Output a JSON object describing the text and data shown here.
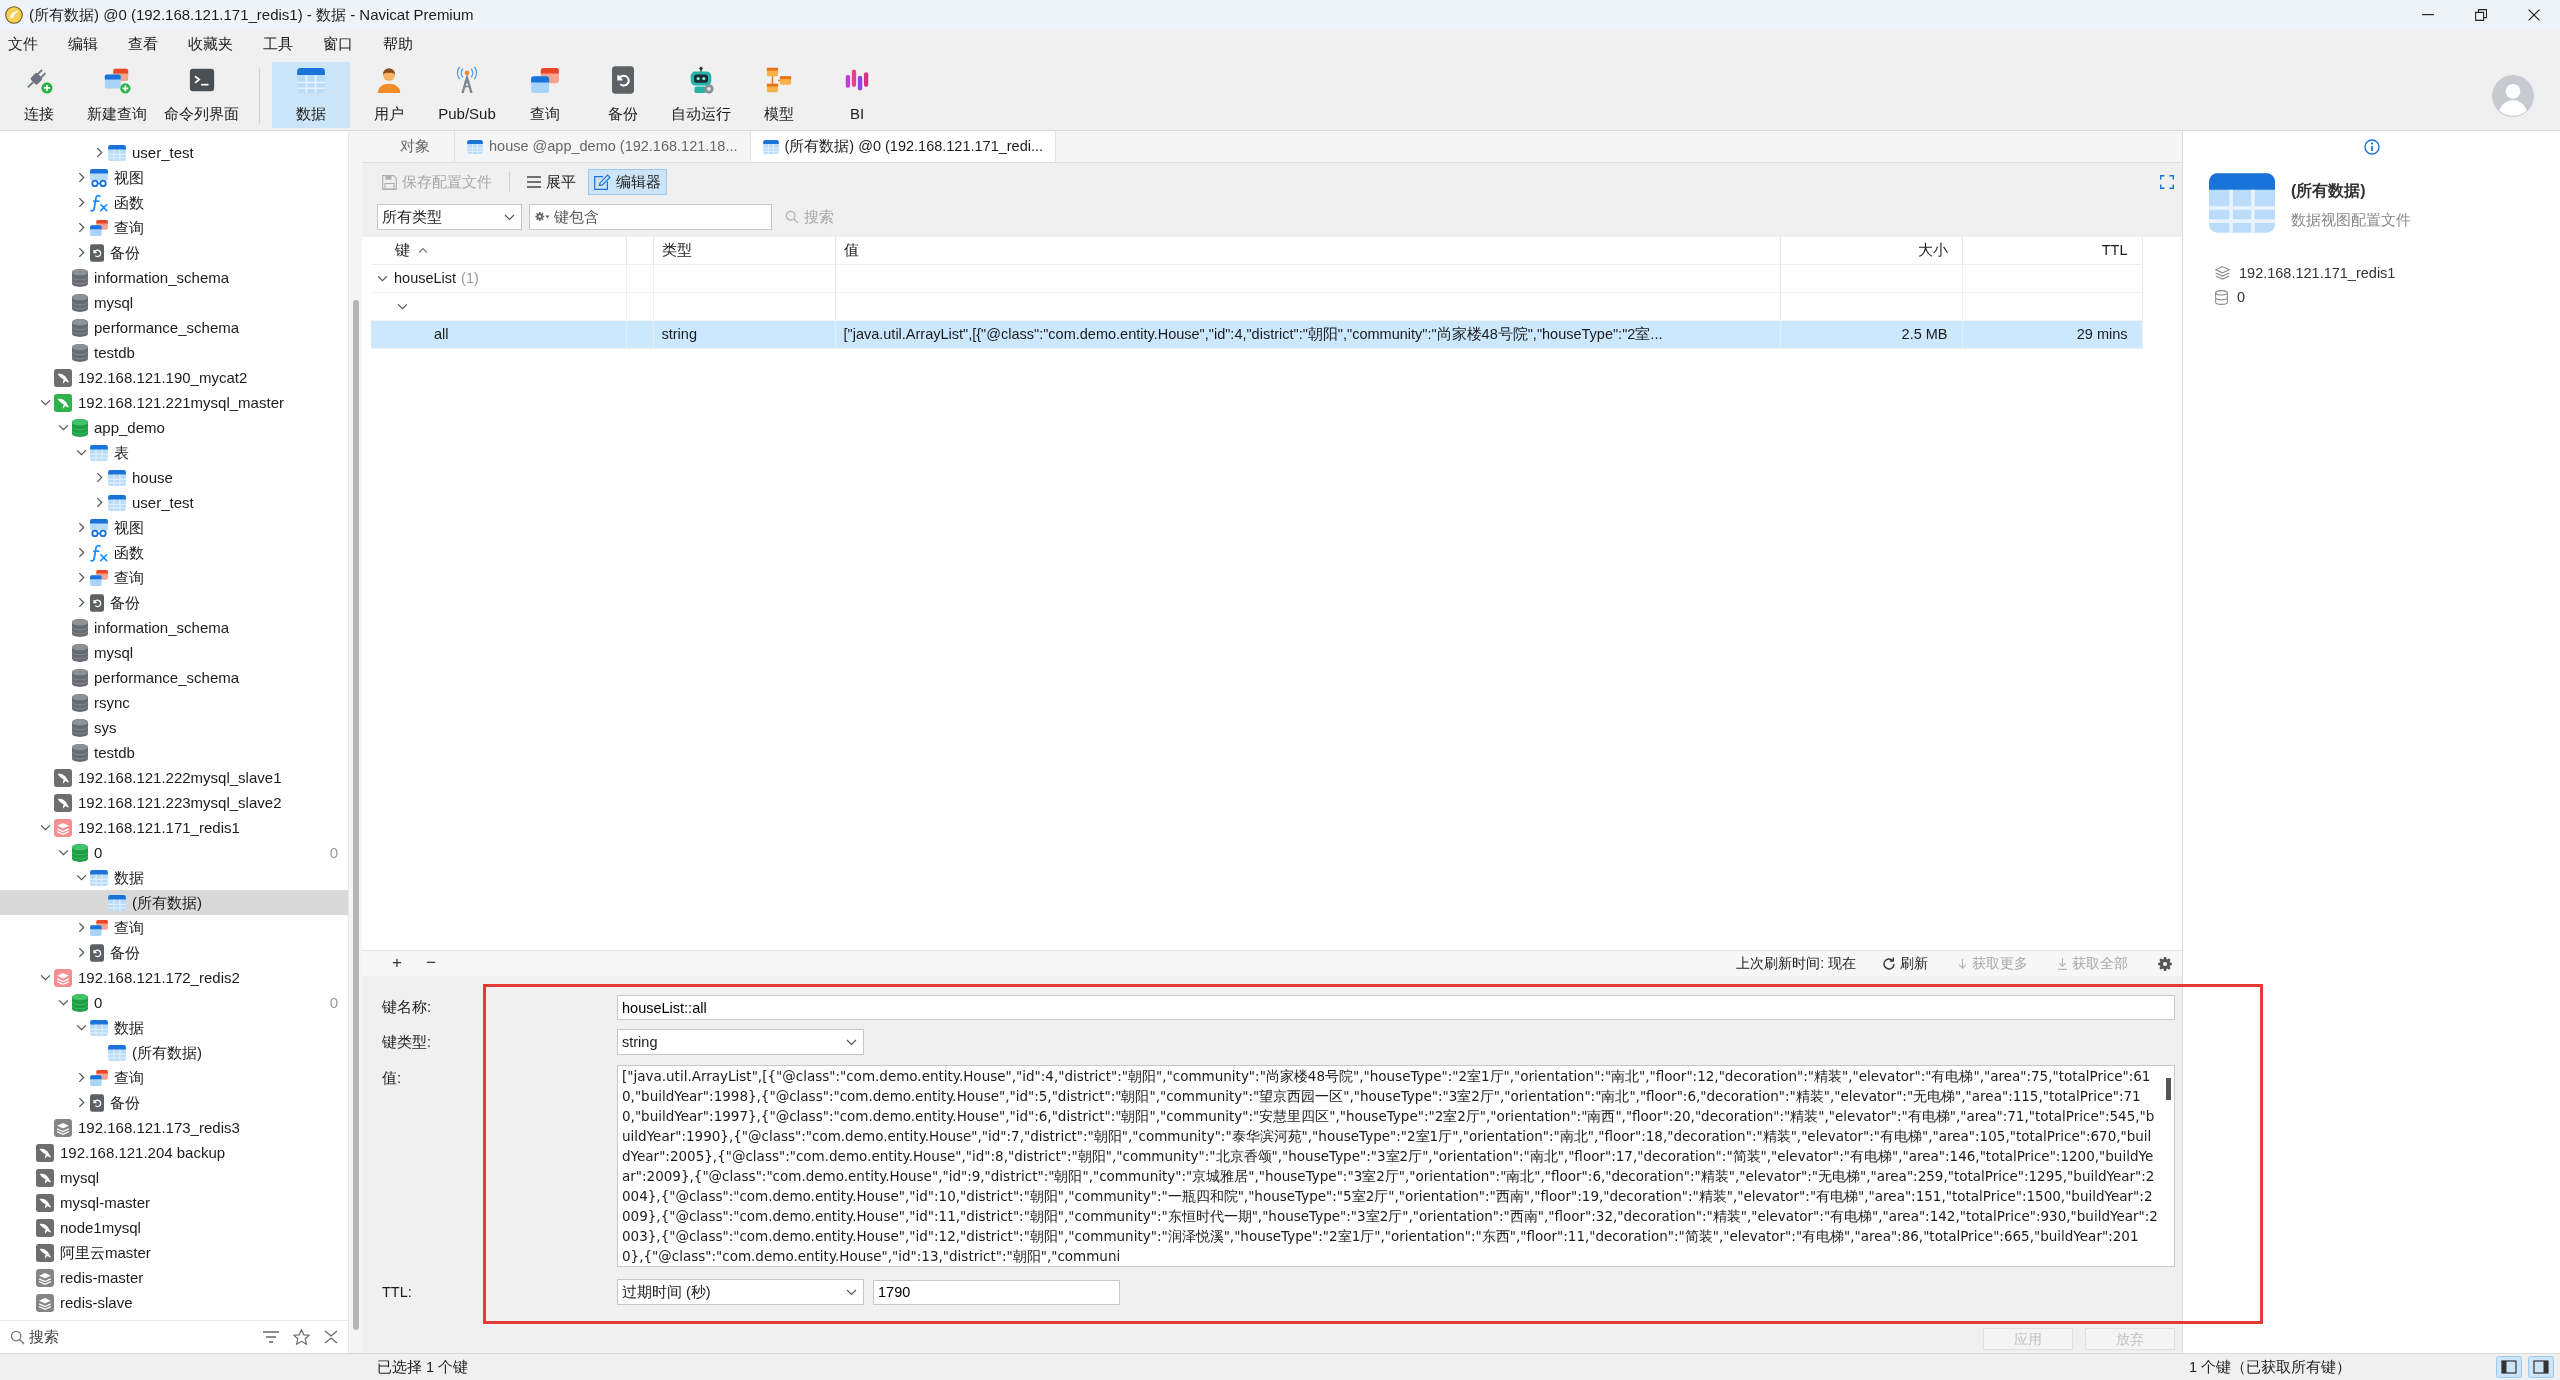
{
  "window": {
    "title": "(所有数据) @0 (192.168.121.171_redis1) - 数据 - Navicat Premium"
  },
  "menu": [
    "文件",
    "编辑",
    "查看",
    "收藏夹",
    "工具",
    "窗口",
    "帮助"
  ],
  "toolbar": {
    "groups": [
      [
        {
          "label": "连接",
          "kind": "connect",
          "selected": false
        },
        {
          "label": "新建查询",
          "kind": "new-query",
          "selected": false
        },
        {
          "label": "命令列界面",
          "kind": "console",
          "selected": false
        }
      ],
      [
        {
          "label": "数据",
          "kind": "data",
          "selected": true
        },
        {
          "label": "用户",
          "kind": "user",
          "selected": false
        },
        {
          "label": "Pub/Sub",
          "kind": "pubsub",
          "selected": false
        },
        {
          "label": "查询",
          "kind": "query",
          "selected": false
        },
        {
          "label": "备份",
          "kind": "backup",
          "selected": false
        },
        {
          "label": "自动运行",
          "kind": "automation",
          "selected": false
        },
        {
          "label": "模型",
          "kind": "model",
          "selected": false
        },
        {
          "label": "BI",
          "kind": "bi",
          "selected": false
        }
      ]
    ]
  },
  "sidebar": {
    "tree": [
      {
        "children": [
          {
            "children": [
              {
                "children": [
                  {
                    "children": [
                      {
                        "label": "user_test",
                        "kind": "table",
                        "expanded": false,
                        "selected": false
                      }
                    ]
                  },
                  {
                    "label": "视图",
                    "kind": "view",
                    "expanded": false,
                    "selected": false
                  },
                  {
                    "label": "函数",
                    "kind": "function",
                    "expanded": false,
                    "selected": false
                  },
                  {
                    "label": "查询",
                    "kind": "query",
                    "expanded": false,
                    "selected": false
                  },
                  {
                    "label": "备份",
                    "kind": "backup",
                    "expanded": false,
                    "selected": false
                  }
                ]
              },
              {
                "label": "information_schema",
                "kind": "database",
                "selected": false
              },
              {
                "label": "mysql",
                "kind": "database",
                "selected": false
              },
              {
                "label": "performance_schema",
                "kind": "database",
                "selected": false
              },
              {
                "label": "testdb",
                "kind": "database",
                "selected": false
              }
            ]
          },
          {
            "label": "192.168.121.190_mycat2",
            "kind": "mysql",
            "selected": false
          },
          {
            "label": "192.168.121.221mysql_master",
            "kind": "mysql",
            "expanded": true,
            "selected": false,
            "children": [
              {
                "label": "app_demo",
                "kind": "database",
                "expanded": true,
                "selected": false,
                "children": [
                  {
                    "label": "表",
                    "kind": "table",
                    "expanded": true,
                    "selected": false,
                    "children": [
                      {
                        "label": "house",
                        "kind": "table",
                        "expanded": false,
                        "selected": false
                      },
                      {
                        "label": "user_test",
                        "kind": "table",
                        "expanded": false,
                        "selected": false
                      }
                    ]
                  },
                  {
                    "label": "视图",
                    "kind": "view",
                    "expanded": false,
                    "selected": false
                  },
                  {
                    "label": "函数",
                    "kind": "function",
                    "expanded": false,
                    "selected": false
                  },
                  {
                    "label": "查询",
                    "kind": "query",
                    "expanded": false,
                    "selected": false
                  },
                  {
                    "label": "备份",
                    "kind": "backup",
                    "expanded": false,
                    "selected": false
                  }
                ]
              },
              {
                "label": "information_schema",
                "kind": "database",
                "selected": false
              },
              {
                "label": "mysql",
                "kind": "database",
                "selected": false
              },
              {
                "label": "performance_schema",
                "kind": "database",
                "selected": false
              },
              {
                "label": "rsync",
                "kind": "database",
                "selected": false
              },
              {
                "label": "sys",
                "kind": "database",
                "selected": false
              },
              {
                "label": "testdb",
                "kind": "database",
                "selected": false
              }
            ]
          },
          {
            "label": "192.168.121.222mysql_slave1",
            "kind": "mysql",
            "selected": false
          },
          {
            "label": "192.168.121.223mysql_slave2",
            "kind": "mysql",
            "selected": false
          },
          {
            "label": "192.168.121.171_redis1",
            "kind": "redis",
            "expanded": true,
            "selected": false,
            "children": [
              {
                "label": "0",
                "kind": "database",
                "expanded": true,
                "selected": false,
                "count": "0",
                "children": [
                  {
                    "label": "数据",
                    "kind": "table",
                    "expanded": true,
                    "selected": false,
                    "children": [
                      {
                        "label": "(所有数据)",
                        "kind": "table",
                        "selected": true
                      }
                    ]
                  },
                  {
                    "label": "查询",
                    "kind": "query",
                    "expanded": false,
                    "selected": false
                  },
                  {
                    "label": "备份",
                    "kind": "backup",
                    "expanded": false,
                    "selected": false
                  }
                ]
              }
            ]
          },
          {
            "label": "192.168.121.172_redis2",
            "kind": "redis",
            "expanded": true,
            "selected": false,
            "children": [
              {
                "label": "0",
                "kind": "database",
                "expanded": true,
                "selected": false,
                "count": "0",
                "children": [
                  {
                    "label": "数据",
                    "kind": "table",
                    "expanded": true,
                    "selected": false,
                    "children": [
                      {
                        "label": "(所有数据)",
                        "kind": "table",
                        "selected": false
                      }
                    ]
                  },
                  {
                    "label": "查询",
                    "kind": "query",
                    "expanded": false,
                    "selected": false
                  },
                  {
                    "label": "备份",
                    "kind": "backup",
                    "expanded": false,
                    "selected": false
                  }
                ]
              }
            ]
          },
          {
            "label": "192.168.121.173_redis3",
            "kind": "redis",
            "selected": false
          }
        ]
      },
      {
        "label": "192.168.121.204 backup",
        "kind": "mysql",
        "selected": false
      },
      {
        "label": "mysql",
        "kind": "mysql",
        "selected": false
      },
      {
        "label": "mysql-master",
        "kind": "mysql",
        "selected": false
      },
      {
        "label": "node1mysql",
        "kind": "mysql",
        "selected": false
      },
      {
        "label": "阿里云master",
        "kind": "mysql",
        "selected": false
      },
      {
        "label": "redis-master",
        "kind": "redis",
        "selected": false
      },
      {
        "label": "redis-slave",
        "kind": "redis",
        "selected": false
      }
    ],
    "search": {
      "placeholder": "搜索"
    }
  },
  "tabs": [
    {
      "label": "对象",
      "kind": "objects",
      "selected": false
    },
    {
      "label": "house @app_demo (192.168.121.18...",
      "kind": "table",
      "selected": false
    },
    {
      "label": "(所有数据) @0 (192.168.121.171_redi...",
      "kind": "table",
      "selected": true
    }
  ],
  "data_view": {
    "toolbar": {
      "save": {
        "label": "保存配置文件",
        "disabled": true
      },
      "modes": [
        {
          "label": "展平",
          "kind": "flat",
          "selected": false
        },
        {
          "label": "编辑器",
          "kind": "editor",
          "selected": true
        }
      ]
    },
    "filter": {
      "type": "所有类型",
      "key": {
        "placeholder": "键包含"
      },
      "search": {
        "label": "搜索",
        "disabled": true
      }
    },
    "table": {
      "columns": [
        {
          "kind": "key",
          "label": "键",
          "sorted_ascending": true
        },
        {
          "kind": "spacer"
        },
        {
          "kind": "type",
          "label": "类型"
        },
        {
          "kind": "value",
          "label": "值"
        },
        {
          "kind": "size",
          "label": "大小"
        },
        {
          "kind": "ttl",
          "label": "TTL"
        }
      ],
      "rows": [
        {
          "key": "houseList",
          "count": "(1)",
          "expanded": true,
          "selected": false,
          "children": [
            {
              "expanded": true,
              "selected": false,
              "children": [
                {
                  "key": "all",
                  "type": "string",
                  "value": "[\"java.util.ArrayList\",[{\"@class\":\"com.demo.entity.House\",\"id\":4,\"district\":\"朝阳\",\"community\":\"尚家楼48号院\",\"houseType\":\"2室...",
                  "size": "2.5 MB",
                  "ttl": "29 mins",
                  "selected": true
                }
              ]
            }
          ]
        }
      ]
    },
    "actions": {
      "add": "+",
      "remove": "−",
      "refreshed": "上次刷新时间: 现在",
      "buttons": [
        {
          "label": "刷新",
          "kind": "refresh",
          "disabled": false
        },
        {
          "label": "获取更多",
          "kind": "more",
          "disabled": true
        },
        {
          "label": "获取全部",
          "kind": "all",
          "disabled": true
        }
      ]
    },
    "editor": {
      "highlighted": true,
      "fields": [
        {
          "kind": "text",
          "label": "键名称:",
          "value": "houseList::all"
        },
        {
          "kind": "select",
          "label": "键类型:",
          "value": "string"
        },
        {
          "kind": "textarea",
          "label": "值:",
          "value": "[\"java.util.ArrayList\",[{\"@class\":\"com.demo.entity.House\",\"id\":4,\"district\":\"朝阳\",\"community\":\"尚家楼48号院\",\"houseType\":\"2室1厅\",\"orientation\":\"南北\",\"floor\":12,\"decoration\":\"精装\",\"elevator\":\"有电梯\",\"area\":75,\"totalPrice\":610,\"buildYear\":1998},{\"@class\":\"com.demo.entity.House\",\"id\":5,\"district\":\"朝阳\",\"community\":\"望京西园一区\",\"houseType\":\"3室2厅\",\"orientation\":\"南北\",\"floor\":6,\"decoration\":\"精装\",\"elevator\":\"无电梯\",\"area\":115,\"totalPrice\":710,\"buildYear\":1997},{\"@class\":\"com.demo.entity.House\",\"id\":6,\"district\":\"朝阳\",\"community\":\"安慧里四区\",\"houseType\":\"2室2厅\",\"orientation\":\"南西\",\"floor\":20,\"decoration\":\"精装\",\"elevator\":\"有电梯\",\"area\":71,\"totalPrice\":545,\"buildYear\":1990},{\"@class\":\"com.demo.entity.House\",\"id\":7,\"district\":\"朝阳\",\"community\":\"泰华滨河苑\",\"houseType\":\"2室1厅\",\"orientation\":\"南北\",\"floor\":18,\"decoration\":\"精装\",\"elevator\":\"有电梯\",\"area\":105,\"totalPrice\":670,\"buildYear\":2005},{\"@class\":\"com.demo.entity.House\",\"id\":8,\"district\":\"朝阳\",\"community\":\"北京香颂\",\"houseType\":\"3室2厅\",\"orientation\":\"南北\",\"floor\":17,\"decoration\":\"简装\",\"elevator\":\"有电梯\",\"area\":146,\"totalPrice\":1200,\"buildYear\":2009},{\"@class\":\"com.demo.entity.House\",\"id\":9,\"district\":\"朝阳\",\"community\":\"京城雅居\",\"houseType\":\"3室2厅\",\"orientation\":\"南北\",\"floor\":6,\"decoration\":\"精装\",\"elevator\":\"无电梯\",\"area\":259,\"totalPrice\":1295,\"buildYear\":2004},{\"@class\":\"com.demo.entity.House\",\"id\":10,\"district\":\"朝阳\",\"community\":\"一瓶四和院\",\"houseType\":\"5室2厅\",\"orientation\":\"西南\",\"floor\":19,\"decoration\":\"精装\",\"elevator\":\"有电梯\",\"area\":151,\"totalPrice\":1500,\"buildYear\":2009},{\"@class\":\"com.demo.entity.House\",\"id\":11,\"district\":\"朝阳\",\"community\":\"东恒时代一期\",\"houseType\":\"3室2厅\",\"orientation\":\"西南\",\"floor\":32,\"decoration\":\"精装\",\"elevator\":\"有电梯\",\"area\":142,\"totalPrice\":930,\"buildYear\":2003},{\"@class\":\"com.demo.entity.House\",\"id\":12,\"district\":\"朝阳\",\"community\":\"润泽悦溪\",\"houseType\":\"2室1厅\",\"orientation\":\"东西\",\"floor\":11,\"decoration\":\"简装\",\"elevator\":\"有电梯\",\"area\":86,\"totalPrice\":665,\"buildYear\":2010},{\"@class\":\"com.demo.entity.House\",\"id\":13,\"district\":\"朝阳\",\"communi"
        },
        {
          "kind": "ttl",
          "label": "TTL:",
          "unit": "过期时间 (秒)",
          "value": "1790"
        }
      ],
      "buttons": [
        {
          "label": "应用",
          "disabled": true
        },
        {
          "label": "放弃",
          "disabled": true
        }
      ]
    }
  },
  "info_panel": {
    "title": "(所有数据)",
    "subtitle": "数据视图配置文件",
    "details": [
      {
        "kind": "connection",
        "text": "192.168.121.171_redis1"
      },
      {
        "kind": "database",
        "text": "0"
      }
    ]
  },
  "status_bar": {
    "left": "已选择 1 个键",
    "right": "1 个键（已获取所有键）"
  }
}
